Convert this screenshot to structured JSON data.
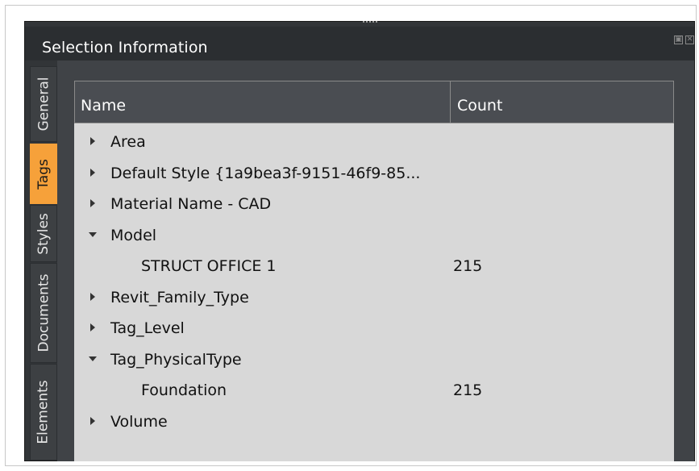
{
  "panel": {
    "title": "Selection Information",
    "title_icons": [
      "restore-icon",
      "close-icon"
    ]
  },
  "side_tabs": [
    {
      "label": "General",
      "active": false
    },
    {
      "label": "Tags",
      "active": true
    },
    {
      "label": "Styles",
      "active": false
    },
    {
      "label": "Documents",
      "active": false
    },
    {
      "label": "Elements",
      "active": false
    }
  ],
  "tree": {
    "columns": {
      "name": "Name",
      "count": "Count"
    },
    "rows": [
      {
        "label": "Area",
        "expanded": false,
        "level": 0,
        "count": ""
      },
      {
        "label": "Default Style {1a9bea3f-9151-46f9-85...",
        "expanded": false,
        "level": 0,
        "count": ""
      },
      {
        "label": "Material Name - CAD",
        "expanded": false,
        "level": 0,
        "count": ""
      },
      {
        "label": "Model",
        "expanded": true,
        "level": 0,
        "count": ""
      },
      {
        "label": "STRUCT OFFICE 1",
        "level": 1,
        "count": "215"
      },
      {
        "label": "Revit_Family_Type",
        "expanded": false,
        "level": 0,
        "count": ""
      },
      {
        "label": "Tag_Level",
        "expanded": false,
        "level": 0,
        "count": ""
      },
      {
        "label": "Tag_PhysicalType",
        "expanded": true,
        "level": 0,
        "count": ""
      },
      {
        "label": "Foundation",
        "level": 1,
        "count": "215"
      },
      {
        "label": "Volume",
        "expanded": false,
        "level": 0,
        "count": ""
      }
    ]
  },
  "colors": {
    "active_tab": "#f6a13a",
    "panel_bg": "#323538",
    "tree_bg": "#d8d8d8",
    "header_bg": "#4a4d52"
  }
}
